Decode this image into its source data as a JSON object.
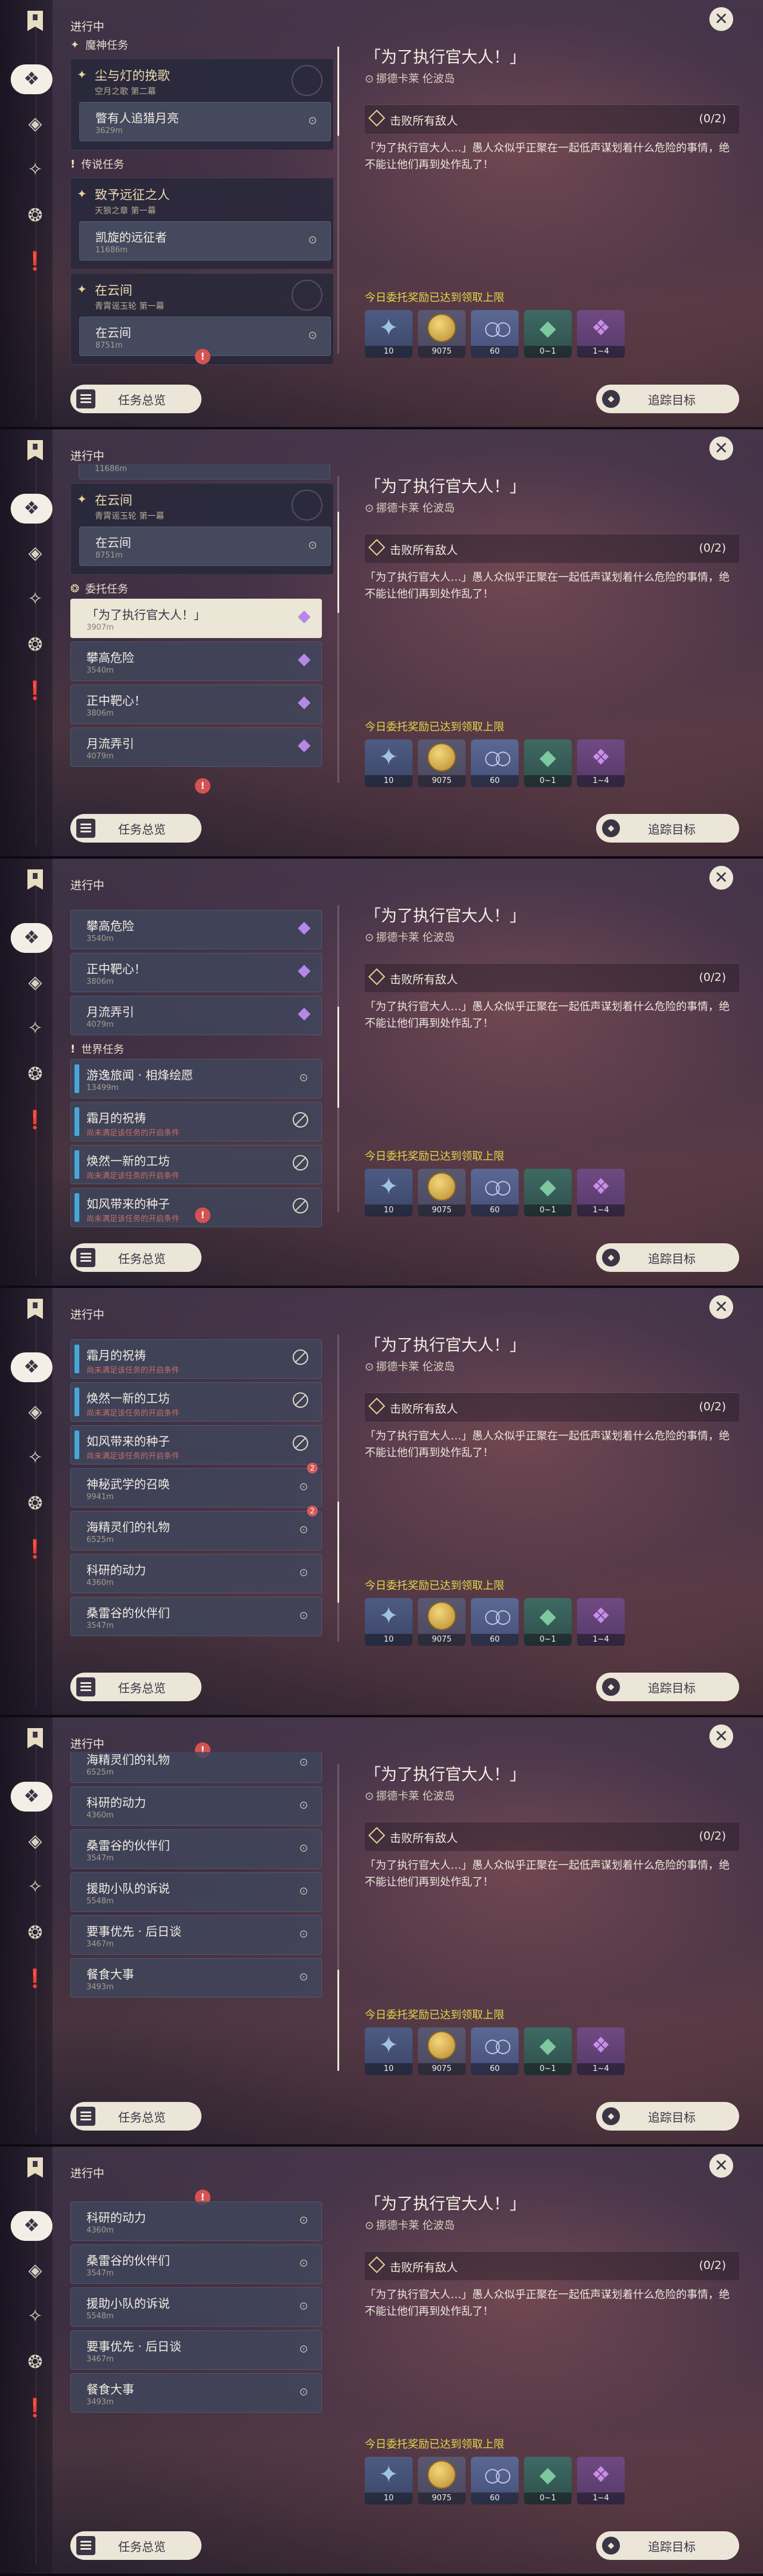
{
  "header": "进行中",
  "close_glyph": "✕",
  "detail": {
    "title": "「为了执行官大人！」",
    "location": "挪德卡莱 伦波岛",
    "objective": "击败所有敌人",
    "objective_count": "(0/2)",
    "description": "「为了执行官大人…」愚人众似乎正聚在一起低声谋划着什么危险的事情，绝不能让他们再到处作乱了！",
    "reward_header": "今日委托奖励已达到领取上限",
    "rewards": [
      {
        "icon": "adventure-exp-icon",
        "count": "10"
      },
      {
        "icon": "mora-icon",
        "count": "9075"
      },
      {
        "icon": "companionship-exp-icon",
        "count": "60"
      },
      {
        "icon": "ore-icon",
        "count": "0~1"
      },
      {
        "icon": "crystal-icon",
        "count": "1~4"
      }
    ]
  },
  "buttons": {
    "overview": "任务总览",
    "track": "追踪目标"
  },
  "sections": {
    "archon": "魔神任务",
    "legend": "传说任务",
    "commission": "委托任务",
    "world": "世界任务"
  },
  "groups": {
    "g1": {
      "title": "尘与灯的挽歌",
      "sub": "空月之歌 第二幕"
    },
    "g2": {
      "title": "致予远征之人",
      "sub": "天狼之章 第一幕"
    },
    "g3": {
      "title": "在云间",
      "sub": "青霄谣玉轮 第一幕"
    }
  },
  "quests": {
    "q1": {
      "name": "瞥有人追猎月亮",
      "dist": "3629m"
    },
    "q2": {
      "name": "凯旋的远征者",
      "dist": "11686m"
    },
    "q3": {
      "name": "在云间",
      "dist": "8751m"
    },
    "c1": {
      "name": "「为了执行官大人！」",
      "dist": "3907m"
    },
    "c2": {
      "name": "攀高危险",
      "dist": "3540m"
    },
    "c3": {
      "name": "正中靶心！",
      "dist": "3806m"
    },
    "c4": {
      "name": "月流弄引",
      "dist": "4079m"
    },
    "w1": {
      "name": "游逸旅闻 · 相烽绘愿",
      "dist": "13499m"
    },
    "w2": {
      "name": "霜月的祝祷",
      "dist": "尚未满足该任务的开启条件"
    },
    "w3": {
      "name": "焕然一新的工坊",
      "dist": "尚未满足该任务的开启条件"
    },
    "w4": {
      "name": "如风带来的种子",
      "dist": "尚未满足该任务的开启条件"
    },
    "w5": {
      "name": "神秘武学的召唤",
      "dist": "9941m"
    },
    "w6": {
      "name": "海精灵们的礼物",
      "dist": "6525m"
    },
    "w7": {
      "name": "科研的动力",
      "dist": "4360m"
    },
    "w8": {
      "name": "桑雷谷的伙伴们",
      "dist": "3547m"
    },
    "w9": {
      "name": "援助小队的诉说",
      "dist": "5548m"
    },
    "w10": {
      "name": "要事优先 · 后日谈",
      "dist": "3467m"
    },
    "w11": {
      "name": "餐食大事",
      "dist": "3493m"
    }
  },
  "badges": {
    "alert": "!",
    "note": "2"
  }
}
